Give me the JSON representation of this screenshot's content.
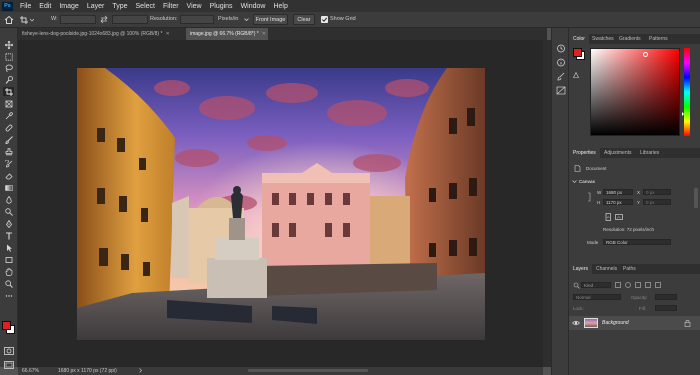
{
  "app": {
    "logo": "Ps"
  },
  "menu": [
    "File",
    "Edit",
    "Image",
    "Layer",
    "Type",
    "Select",
    "Filter",
    "View",
    "Plugins",
    "Window",
    "Help"
  ],
  "options": {
    "w_label": "W:",
    "h_label": "H:",
    "resolution_label": "Resolution:",
    "resolution_unit": "Pixels/in",
    "front_image_label": "Front Image",
    "clear_label": "Clear",
    "show_grid_label": "Show Grid",
    "show_grid_checked": true
  },
  "doc_tabs": [
    {
      "label": "fisheye-lens-dog-poolside.jpg-1024x683.jpg @ 100% (RGB/8) *",
      "active": false
    },
    {
      "label": "image.jpg @ 66.7% (RGB/8*) *",
      "active": true
    }
  ],
  "status": {
    "zoom": "66.67%",
    "info": "1680 px x 1170 px (72 ppi)"
  },
  "color_panel": {
    "tabs": [
      "Color",
      "Swatches",
      "Gradients",
      "Patterns"
    ],
    "hue_color": "#ff0000"
  },
  "properties_panel": {
    "tabs": [
      "Properties",
      "Adjustments",
      "Libraries"
    ],
    "document_label": "Document",
    "canvas_label": "Canvas",
    "w_label": "W",
    "w_value": "1680 px",
    "x_label": "X",
    "x_value": "0 px",
    "h_label": "H",
    "h_value": "1170 px",
    "y_label": "Y",
    "y_value": "0 px",
    "resolution_text": "Resolution: 72 pixels/inch",
    "mode_label": "Mode",
    "mode_value": "RGB Color"
  },
  "layers_panel": {
    "tabs": [
      "Layers",
      "Channels",
      "Paths"
    ],
    "search_placeholder": "Kind",
    "blend_mode": "Normal",
    "opacity_label": "Opacity:",
    "lock_label": "Lock:",
    "fill_label": "Fill:",
    "layers": [
      {
        "name": "Background",
        "visible": true,
        "locked": true
      }
    ]
  },
  "colors": {
    "foreground": "#e02020",
    "background": "#ffffff",
    "accent": "#31a8ff"
  }
}
